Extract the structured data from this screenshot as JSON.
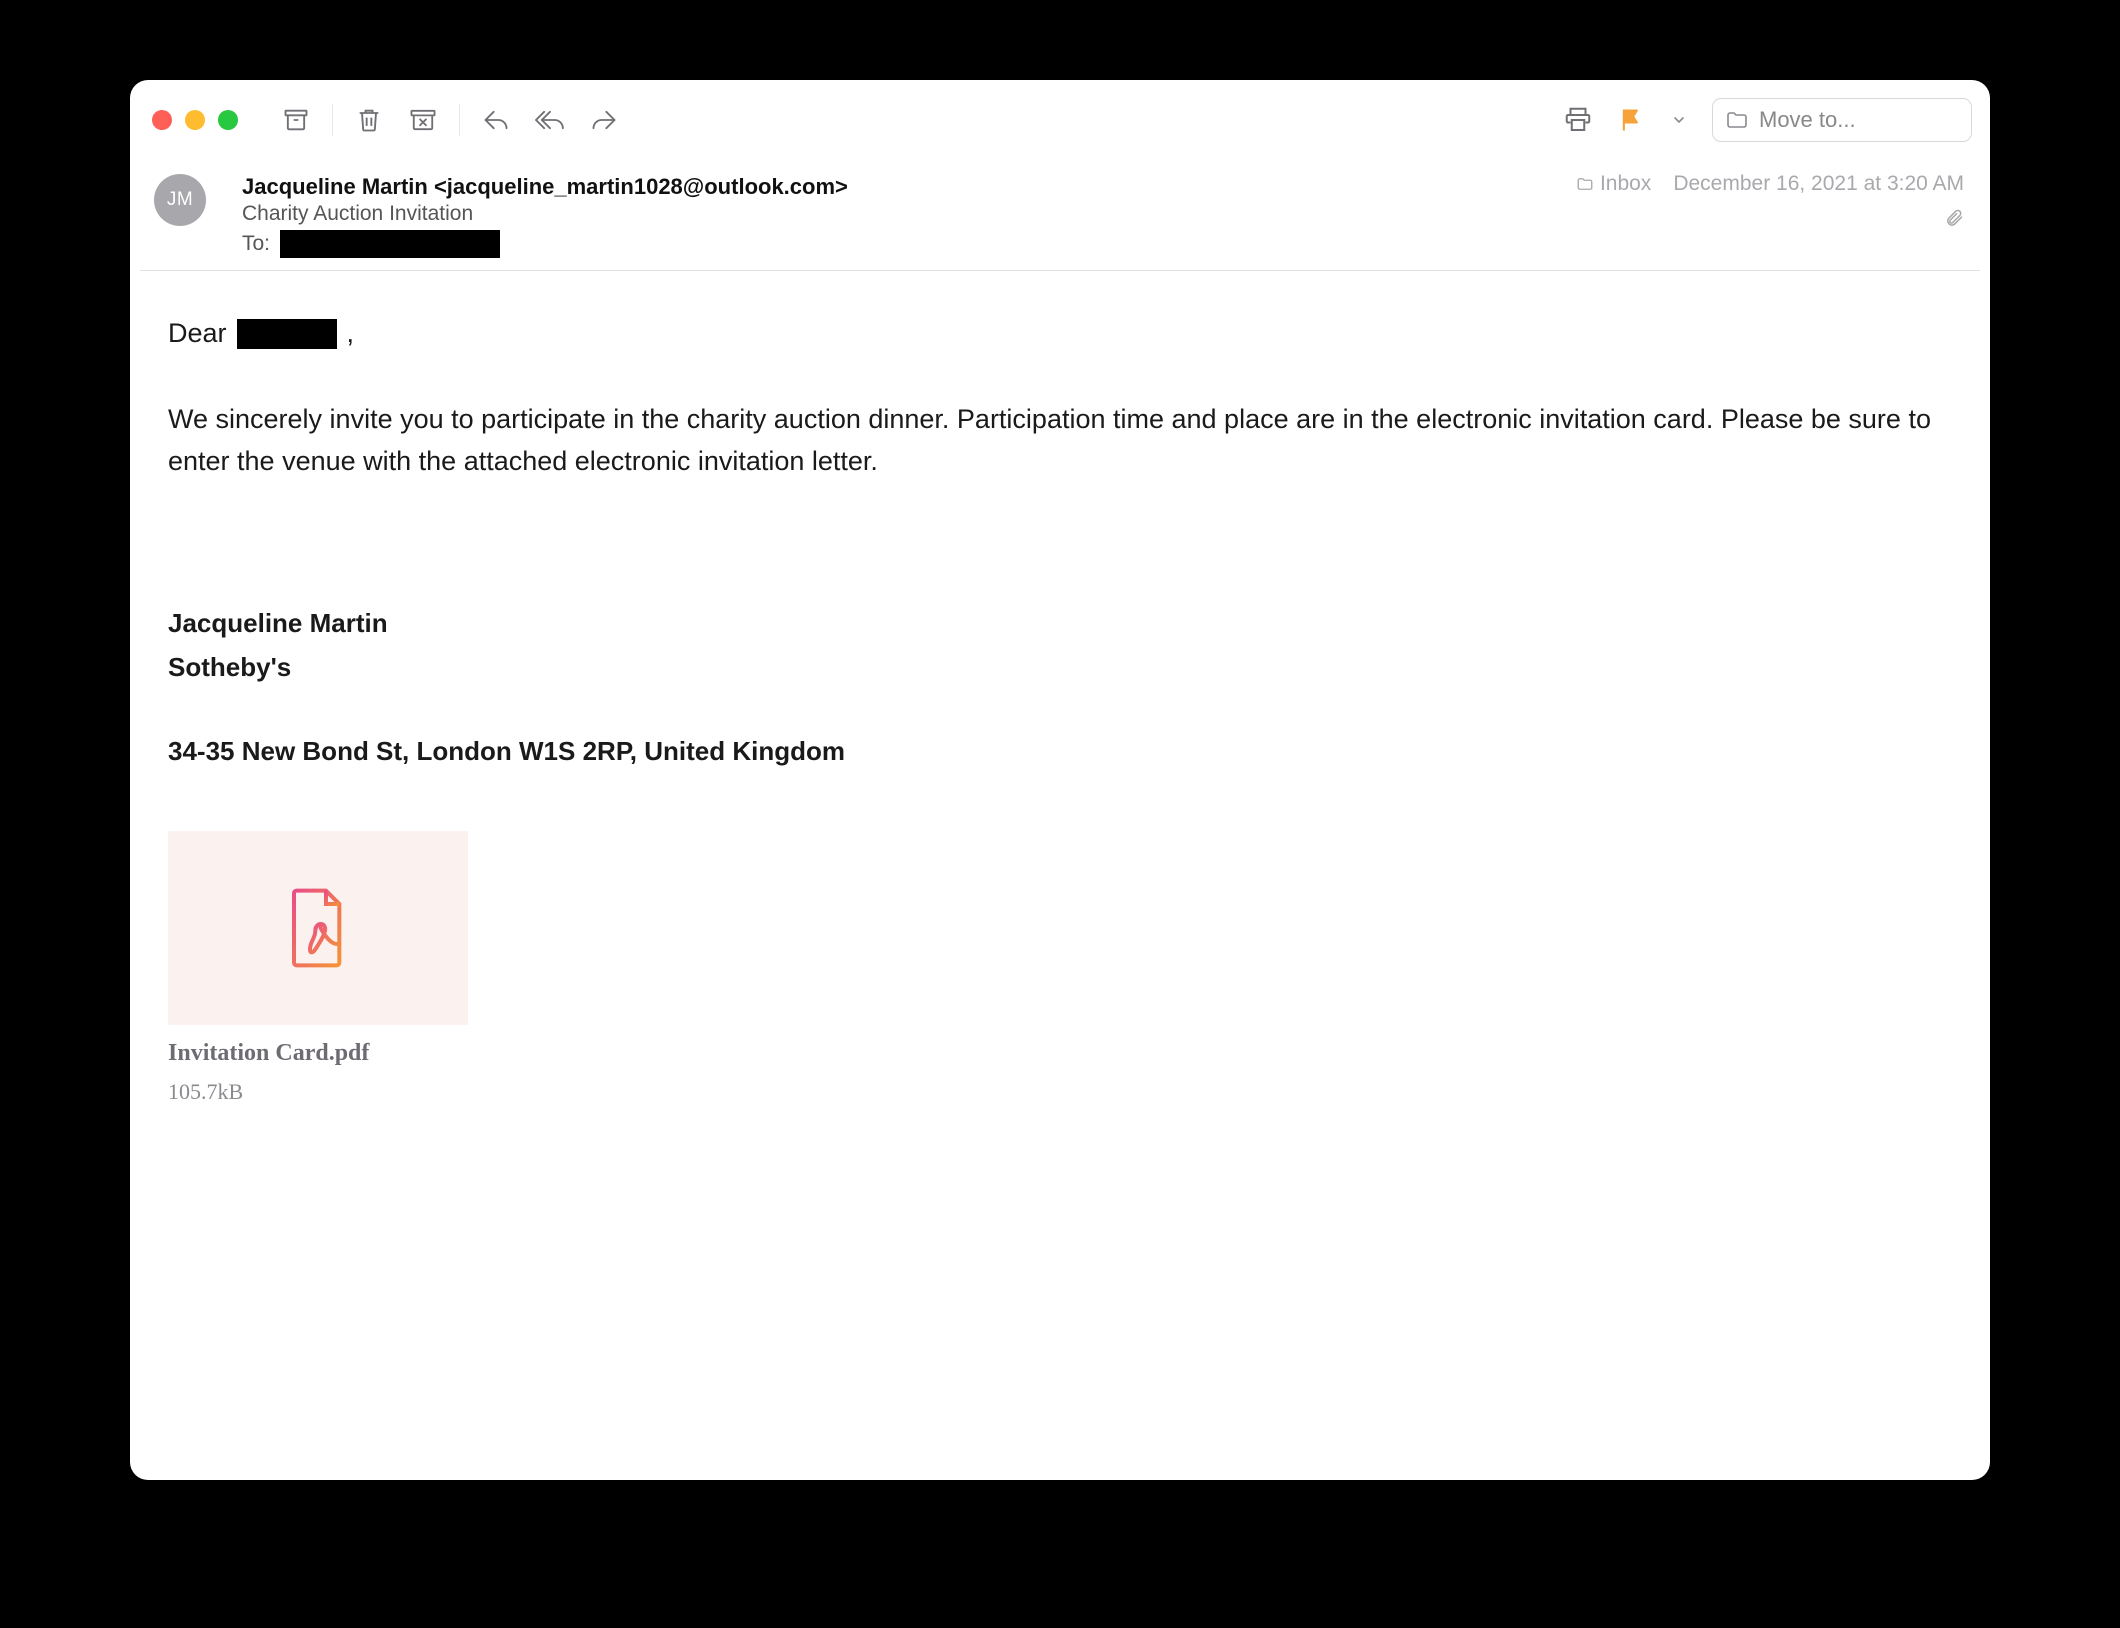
{
  "toolbar": {
    "move_to_placeholder": "Move to..."
  },
  "header": {
    "avatar_initials": "JM",
    "from": "Jacqueline Martin <jacqueline_martin1028@outlook.com>",
    "subject": "Charity Auction Invitation",
    "to_label": "To:",
    "folder": "Inbox",
    "date": "December 16, 2021 at 3:20 AM"
  },
  "body": {
    "greeting_prefix": "Dear",
    "greeting_suffix": ",",
    "paragraph1": "We sincerely invite you to participate in the charity auction dinner. Participation time and place are in the electronic invitation card. Please be sure to enter the venue with the attached electronic invitation letter.",
    "signature_name": "Jacqueline Martin",
    "signature_company": "Sotheby's",
    "signature_address": "34-35 New Bond St, London W1S 2RP, United Kingdom"
  },
  "attachment": {
    "filename": "Invitation Card.pdf",
    "size": "105.7kB"
  }
}
